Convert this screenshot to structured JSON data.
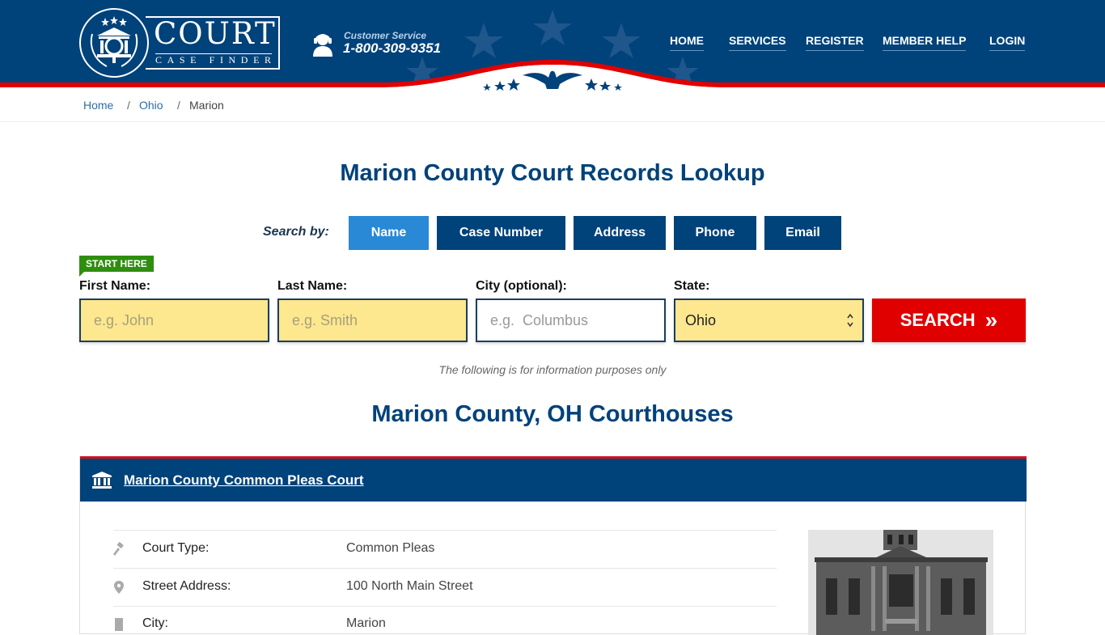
{
  "header": {
    "logo_title": "COURT",
    "logo_subtitle": "CASE FINDER",
    "customer_service_label": "Customer Service",
    "customer_service_phone": "1-800-309-9351",
    "nav": [
      {
        "label": "HOME"
      },
      {
        "label": "SERVICES"
      },
      {
        "label": "REGISTER"
      },
      {
        "label": "MEMBER HELP"
      },
      {
        "label": "LOGIN"
      }
    ]
  },
  "breadcrumb": {
    "items": [
      {
        "label": "Home"
      },
      {
        "label": "Ohio"
      },
      {
        "label": "Marion"
      }
    ],
    "separator": "/"
  },
  "search": {
    "title": "Marion County Court Records Lookup",
    "search_by_label": "Search by:",
    "tabs": [
      {
        "label": "Name",
        "active": true
      },
      {
        "label": "Case Number",
        "active": false
      },
      {
        "label": "Address",
        "active": false
      },
      {
        "label": "Phone",
        "active": false
      },
      {
        "label": "Email",
        "active": false
      }
    ],
    "start_here": "START HERE",
    "fields": {
      "first_name": {
        "label": "First Name:",
        "placeholder": "e.g. John",
        "value": ""
      },
      "last_name": {
        "label": "Last Name:",
        "placeholder": "e.g. Smith",
        "value": ""
      },
      "city": {
        "label": "City (optional):",
        "placeholder": "e.g.  Columbus",
        "value": ""
      },
      "state": {
        "label": "State:",
        "value": "Ohio"
      }
    },
    "search_button": "SEARCH",
    "search_button_icon": "»",
    "disclaimer": "The following is for information purposes only"
  },
  "courthouses": {
    "title": "Marion County, OH Courthouses",
    "courts": [
      {
        "name": "Marion County Common Pleas Court",
        "details": [
          {
            "icon": "gavel-icon",
            "label": "Court Type:",
            "value": "Common Pleas"
          },
          {
            "icon": "map-pin-icon",
            "label": "Street Address:",
            "value": "100 North Main Street"
          },
          {
            "icon": "building-icon",
            "label": "City:",
            "value": "Marion"
          }
        ]
      }
    ]
  },
  "colors": {
    "brand_blue": "#00427a",
    "active_tab": "#2a89d6",
    "search_red": "#e00000",
    "start_green": "#2e8e0f",
    "input_yellow": "#fde78f"
  }
}
